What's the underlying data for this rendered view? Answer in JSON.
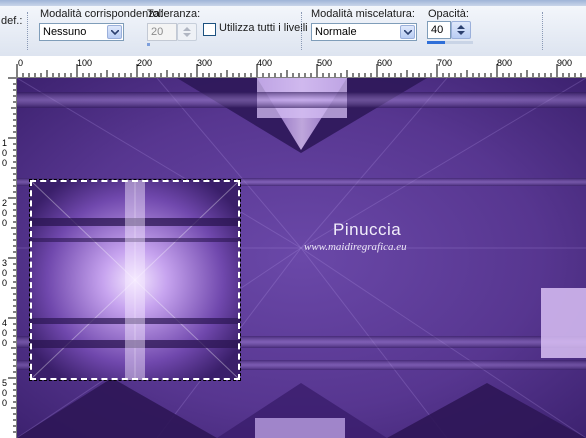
{
  "options_bar": {
    "title_fragment": "def.:",
    "match_mode": {
      "label": "Modalità corrispondenza:",
      "value": "Nessuno"
    },
    "tolerance": {
      "label": "Tolleranza:",
      "value": "20"
    },
    "use_all_layers": {
      "label": "Utilizza tutti i livelli",
      "checked": false
    },
    "blend_mode": {
      "label": "Modalità miscelatura:",
      "value": "Normale"
    },
    "opacity": {
      "label": "Opacità:",
      "value": "40",
      "level": 0.4
    }
  },
  "ruler_horizontal": {
    "labels": [
      "0",
      "100",
      "200",
      "300",
      "400",
      "500",
      "600",
      "700",
      "800",
      "900"
    ]
  },
  "ruler_vertical": {
    "labels": [
      "1",
      "0",
      "0",
      "2",
      "0",
      "0",
      "3",
      "0",
      "0",
      "4",
      "0",
      "0",
      "5",
      "0",
      "0"
    ]
  },
  "canvas": {
    "watermark_name": "Pinuccia",
    "watermark_url": "www.maidiregrafica.eu",
    "colors": {
      "base": "#5b3a94",
      "light": "#d8b8f2",
      "dark": "#2a1550"
    }
  }
}
